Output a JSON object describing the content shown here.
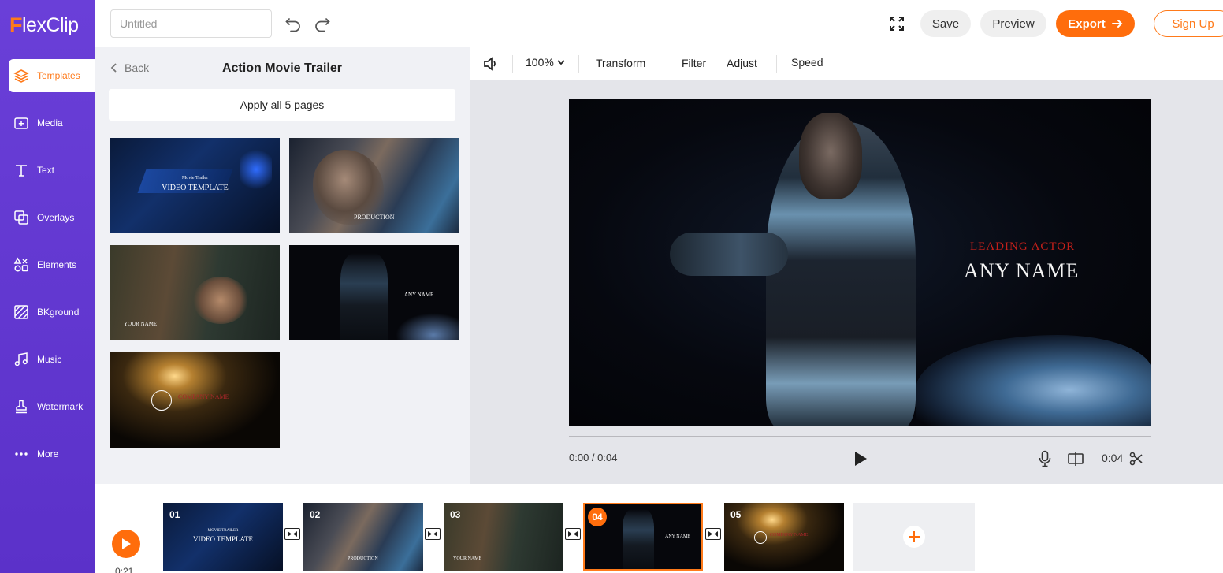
{
  "app": {
    "logo_f": "F",
    "logo_text": "lexClip"
  },
  "sidebar": {
    "items": [
      {
        "label": "Templates",
        "icon": "layers-icon"
      },
      {
        "label": "Media",
        "icon": "media-add-icon"
      },
      {
        "label": "Text",
        "icon": "text-icon"
      },
      {
        "label": "Overlays",
        "icon": "overlays-icon"
      },
      {
        "label": "Elements",
        "icon": "elements-icon"
      },
      {
        "label": "BKground",
        "icon": "background-icon"
      },
      {
        "label": "Music",
        "icon": "music-icon"
      },
      {
        "label": "Watermark",
        "icon": "stamp-icon"
      },
      {
        "label": "More",
        "icon": "more-dots-icon"
      }
    ]
  },
  "topbar": {
    "title_placeholder": "Untitled",
    "save": "Save",
    "preview": "Preview",
    "export": "Export",
    "signup": "Sign Up"
  },
  "panel": {
    "back": "Back",
    "title": "Action Movie Trailer",
    "apply": "Apply all 5 pages",
    "thumbs": [
      {
        "line1": "Movie Trailer",
        "line2": "VIDEO TEMPLATE"
      },
      {
        "line1": "PRODUCTION"
      },
      {
        "line1": "YOUR NAME"
      },
      {
        "line1": "ANY NAME"
      },
      {
        "line1": "COMPANY NAME"
      }
    ]
  },
  "toolbar": {
    "zoom": "100%",
    "transform": "Transform",
    "filter": "Filter",
    "adjust": "Adjust",
    "speed": "Speed"
  },
  "stage": {
    "caption_small": "LEADING ACTOR",
    "caption_big": "ANY NAME",
    "time": "0:00 / 0:04",
    "duration": "0:04"
  },
  "timeline": {
    "total": "0:21",
    "clips": [
      {
        "num": "01",
        "line1": "MOVIE TRAILER",
        "line2": "VIDEO TEMPLATE"
      },
      {
        "num": "02",
        "line1": "PRODUCTION"
      },
      {
        "num": "03",
        "line1": "YOUR NAME"
      },
      {
        "num": "04",
        "line1": "ANY NAME"
      },
      {
        "num": "05",
        "line1": "COMPANY NAME"
      }
    ],
    "active_clip": "04"
  },
  "colors": {
    "accent": "#ff6d0c",
    "sidebar": "#5b31c9"
  }
}
